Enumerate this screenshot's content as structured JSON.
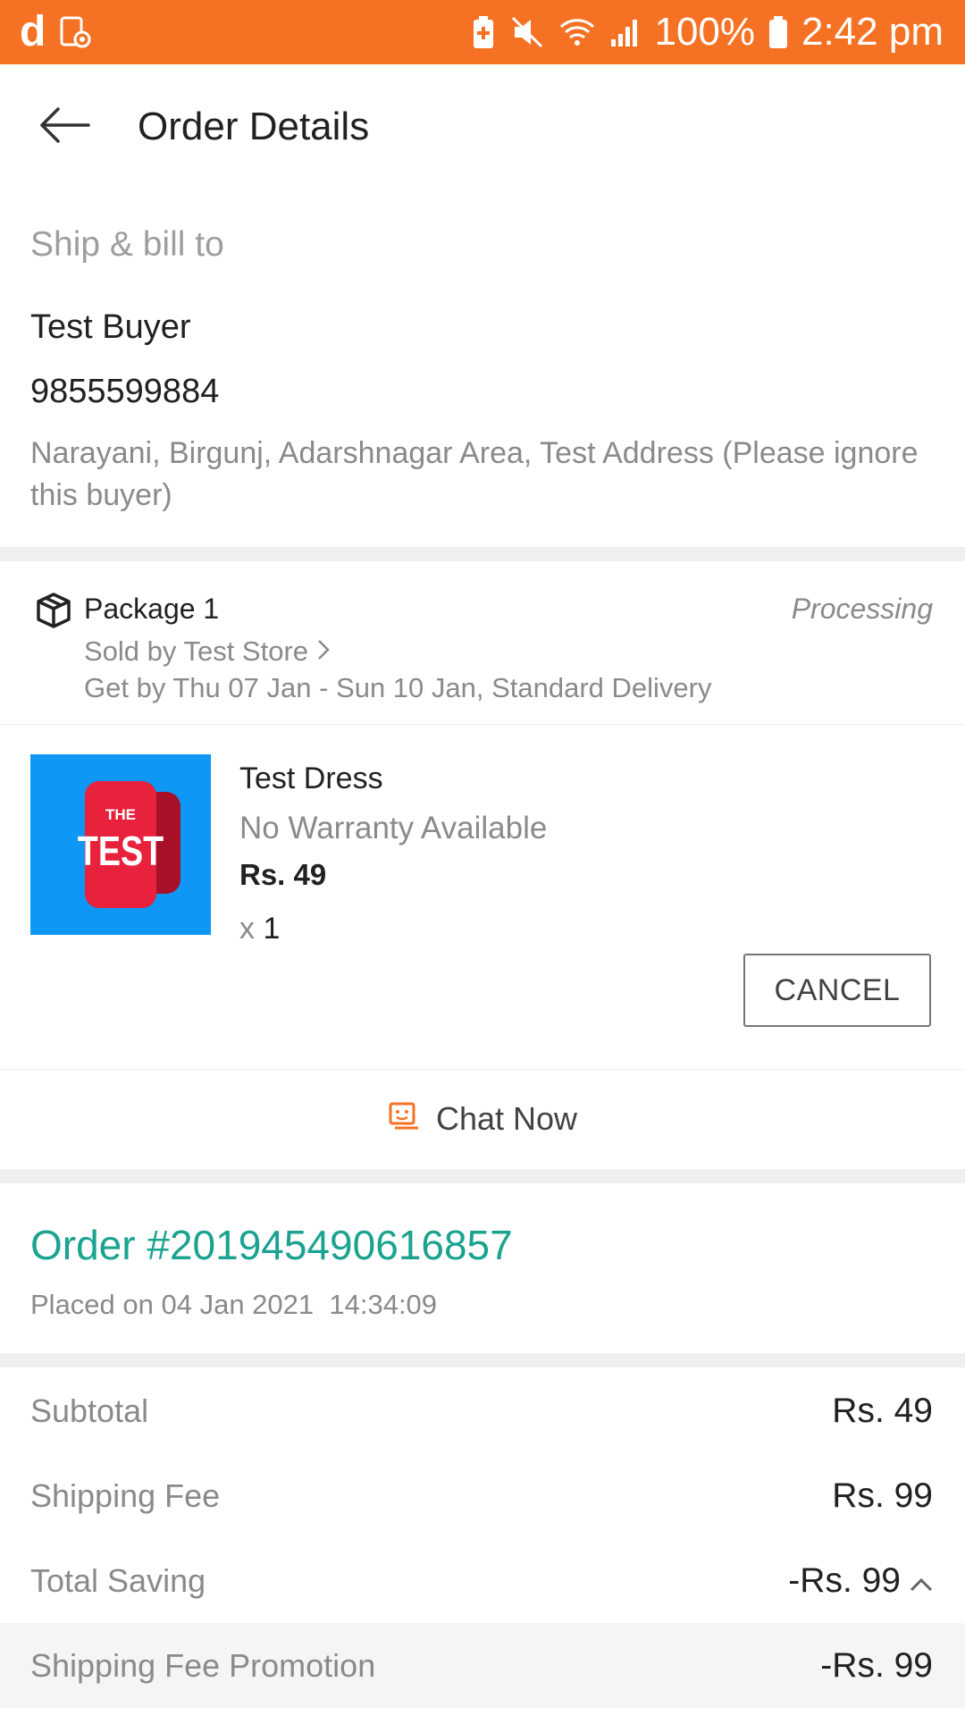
{
  "status_bar": {
    "logo": "d",
    "battery_percent": "100%",
    "time": "2:42 pm",
    "icons": [
      "daraz-logo-icon",
      "screen-record-icon",
      "battery-saver-icon",
      "mute-icon",
      "wifi-icon",
      "signal-icon",
      "battery-icon"
    ]
  },
  "header": {
    "title": "Order Details",
    "back_icon": "arrow-left-icon"
  },
  "shipping": {
    "label": "Ship & bill to",
    "name": "Test Buyer",
    "phone": "9855599884",
    "address": "Narayani, Birgunj, Adarshnagar Area, Test Address (Please ignore this buyer)"
  },
  "package": {
    "title": "Package 1",
    "status": "Processing",
    "seller": "Sold by Test Store",
    "delivery": "Get by Thu 07 Jan - Sun 10 Jan, Standard Delivery",
    "item": {
      "thumb_text_top": "THE",
      "thumb_text_main": "TEST",
      "name": "Test Dress",
      "warranty": "No Warranty Available",
      "price": "Rs. 49",
      "qty_prefix": "x",
      "qty": "1"
    },
    "cancel_label": "CANCEL",
    "chat_label": "Chat Now"
  },
  "order": {
    "number": "Order #201945490616857",
    "placed": "Placed on 04 Jan 2021  14:34:09"
  },
  "summary": {
    "subtotal_label": "Subtotal",
    "subtotal_value": "Rs. 49",
    "shipping_label": "Shipping Fee",
    "shipping_value": "Rs. 99",
    "saving_label": "Total Saving",
    "saving_value": "-Rs. 99",
    "promo_label": "Shipping Fee Promotion",
    "promo_value": "-Rs. 99"
  },
  "colors": {
    "brand_orange": "#f57224",
    "order_teal": "#1ba38f",
    "thumb_blue": "#0e97f5",
    "thumb_red": "#e8223c"
  }
}
